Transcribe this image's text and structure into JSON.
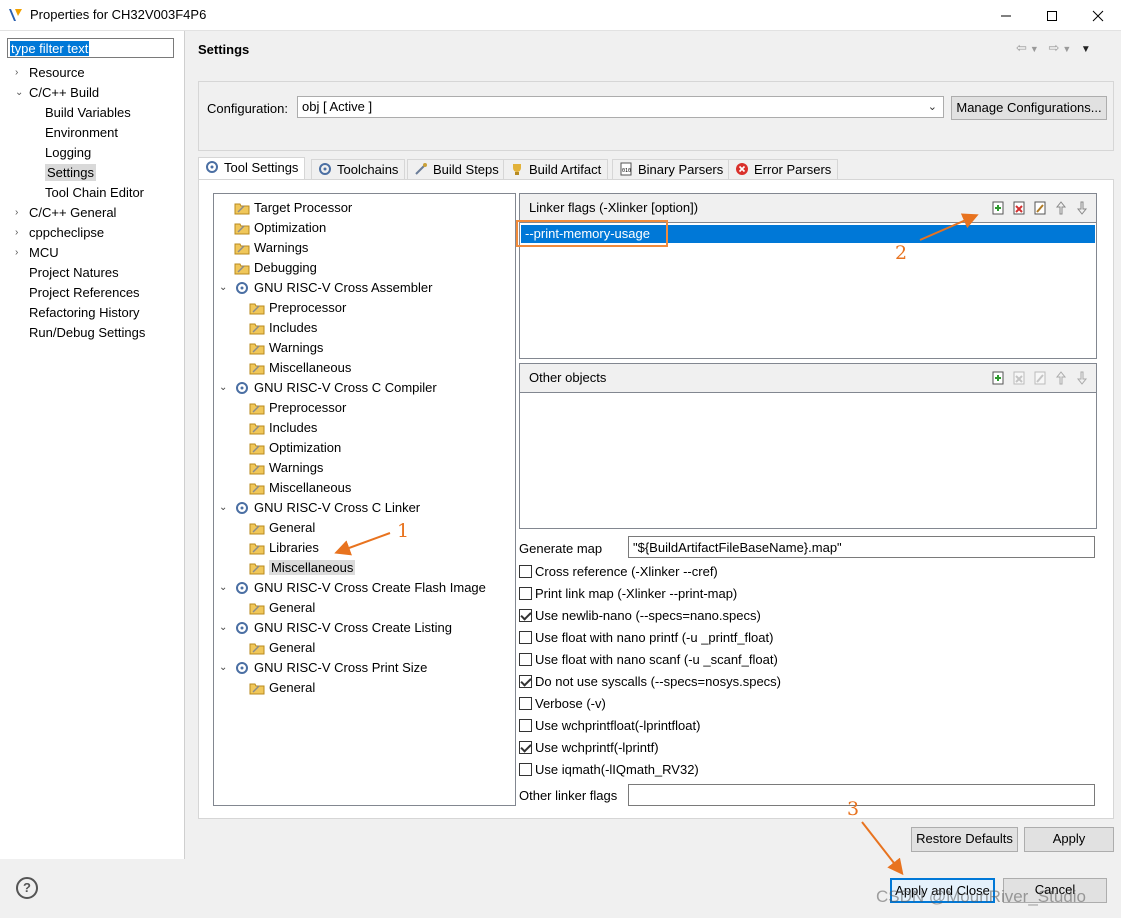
{
  "window": {
    "title": "Properties for CH32V003F4P6"
  },
  "filter": {
    "text": "type filter text"
  },
  "nav": [
    {
      "label": "Resource",
      "level": 0,
      "arrow": "›"
    },
    {
      "label": "C/C++ Build",
      "level": 0,
      "arrow": "⌄"
    },
    {
      "label": "Build Variables",
      "level": 1
    },
    {
      "label": "Environment",
      "level": 1
    },
    {
      "label": "Logging",
      "level": 1
    },
    {
      "label": "Settings",
      "level": 1,
      "selected": true
    },
    {
      "label": "Tool Chain Editor",
      "level": 1
    },
    {
      "label": "C/C++ General",
      "level": 0,
      "arrow": "›"
    },
    {
      "label": "cppcheclipse",
      "level": 0,
      "arrow": "›"
    },
    {
      "label": "MCU",
      "level": 0,
      "arrow": "›"
    },
    {
      "label": "Project Natures",
      "level": 0
    },
    {
      "label": "Project References",
      "level": 0
    },
    {
      "label": "Refactoring History",
      "level": 0
    },
    {
      "label": "Run/Debug Settings",
      "level": 0
    }
  ],
  "page": {
    "title": "Settings"
  },
  "config": {
    "label": "Configuration:",
    "value": "obj  [ Active ]",
    "manage_label": "Manage Configurations..."
  },
  "tabs": [
    "Tool Settings",
    "Toolchains",
    "Build Steps",
    "Build Artifact",
    "Binary Parsers",
    "Error Parsers"
  ],
  "tree": [
    {
      "label": "Target Processor",
      "level": 1
    },
    {
      "label": "Optimization",
      "level": 1
    },
    {
      "label": "Warnings",
      "level": 1
    },
    {
      "label": "Debugging",
      "level": 1
    },
    {
      "label": "GNU RISC-V Cross Assembler",
      "level": 0
    },
    {
      "label": "Preprocessor",
      "level": 2
    },
    {
      "label": "Includes",
      "level": 2
    },
    {
      "label": "Warnings",
      "level": 2
    },
    {
      "label": "Miscellaneous",
      "level": 2
    },
    {
      "label": "GNU RISC-V Cross C Compiler",
      "level": 0
    },
    {
      "label": "Preprocessor",
      "level": 2
    },
    {
      "label": "Includes",
      "level": 2
    },
    {
      "label": "Optimization",
      "level": 2
    },
    {
      "label": "Warnings",
      "level": 2
    },
    {
      "label": "Miscellaneous",
      "level": 2
    },
    {
      "label": "GNU RISC-V Cross C Linker",
      "level": 0
    },
    {
      "label": "General",
      "level": 2
    },
    {
      "label": "Libraries",
      "level": 2
    },
    {
      "label": "Miscellaneous",
      "level": 2,
      "selected": true
    },
    {
      "label": "GNU RISC-V Cross Create Flash Image",
      "level": 0
    },
    {
      "label": "General",
      "level": 2
    },
    {
      "label": "GNU RISC-V Cross Create Listing",
      "level": 0
    },
    {
      "label": "General",
      "level": 2
    },
    {
      "label": "GNU RISC-V Cross Print Size",
      "level": 0
    },
    {
      "label": "General",
      "level": 2
    }
  ],
  "linker_flags": {
    "title": "Linker flags (-Xlinker [option])",
    "items": [
      "--print-memory-usage"
    ]
  },
  "other_objects": {
    "title": "Other objects"
  },
  "generate_map": {
    "label": "Generate map",
    "value": "\"${BuildArtifactFileBaseName}.map\""
  },
  "options": [
    {
      "label": "Cross reference (-Xlinker --cref)",
      "checked": false
    },
    {
      "label": "Print link map (-Xlinker --print-map)",
      "checked": false
    },
    {
      "label": "Use newlib-nano (--specs=nano.specs)",
      "checked": true
    },
    {
      "label": "Use float with nano printf (-u _printf_float)",
      "checked": false
    },
    {
      "label": "Use float with nano scanf (-u _scanf_float)",
      "checked": false
    },
    {
      "label": "Do not use syscalls (--specs=nosys.specs)",
      "checked": true
    },
    {
      "label": "Verbose (-v)",
      "checked": false
    },
    {
      "label": "Use wchprintfloat(-lprintfloat)",
      "checked": false
    },
    {
      "label": "Use wchprintf(-lprintf)",
      "checked": true
    },
    {
      "label": "Use iqmath(-lIQmath_RV32)",
      "checked": false
    }
  ],
  "other_linker_flags": {
    "label": "Other linker flags",
    "value": ""
  },
  "buttons": {
    "restore": "Restore Defaults",
    "apply": "Apply",
    "apply_close": "Apply and Close",
    "cancel": "Cancel"
  },
  "annotations": [
    "1",
    "2",
    "3"
  ],
  "watermark": "CSDN @MounRiver_Studio",
  "colors": {
    "accent": "#0078d7",
    "annotation": "#e8731f"
  }
}
